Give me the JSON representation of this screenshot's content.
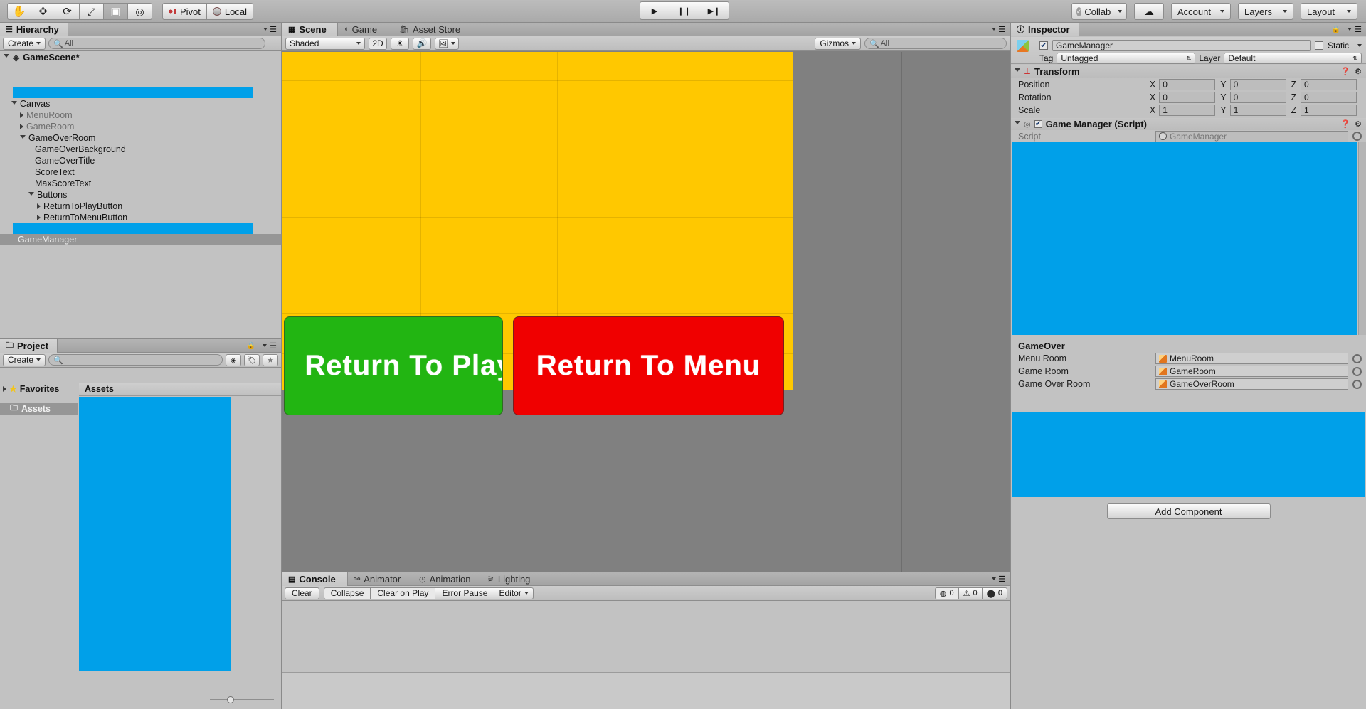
{
  "toolbar": {
    "tools": [
      {
        "name": "hand-tool",
        "glyph": "✋",
        "active": false
      },
      {
        "name": "move-tool",
        "glyph": "✥",
        "active": false
      },
      {
        "name": "rotate-tool",
        "glyph": "⟳",
        "active": false
      },
      {
        "name": "scale-tool",
        "glyph": "⤢",
        "active": false
      },
      {
        "name": "rect-tool",
        "glyph": "▣",
        "active": true
      },
      {
        "name": "transform-tool",
        "glyph": "◎",
        "active": false
      }
    ],
    "pivot_label": "Pivot",
    "local_label": "Local",
    "play_label": "▶",
    "pause_label": "❙❙",
    "step_label": "▶❙",
    "collab_label": "Collab",
    "cloud_label": "☁",
    "account_label": "Account",
    "layers_label": "Layers",
    "layout_label": "Layout"
  },
  "hierarchy": {
    "tab_label": "Hierarchy",
    "create_label": "Create",
    "search_placeholder": "All",
    "scene_name": "GameScene*",
    "items": [
      {
        "label": "",
        "depth": 1,
        "arrow": "none",
        "selected": true,
        "dim": false
      },
      {
        "label": "Canvas",
        "depth": 1,
        "arrow": "open",
        "selected": false,
        "dim": false
      },
      {
        "label": "MenuRoom",
        "depth": 2,
        "arrow": "closed",
        "selected": false,
        "dim": true
      },
      {
        "label": "GameRoom",
        "depth": 2,
        "arrow": "closed",
        "selected": false,
        "dim": true
      },
      {
        "label": "GameOverRoom",
        "depth": 2,
        "arrow": "open",
        "selected": false,
        "dim": false
      },
      {
        "label": "GameOverBackground",
        "depth": 3,
        "arrow": "none",
        "selected": false,
        "dim": false
      },
      {
        "label": "GameOverTitle",
        "depth": 3,
        "arrow": "none",
        "selected": false,
        "dim": false
      },
      {
        "label": "ScoreText",
        "depth": 3,
        "arrow": "none",
        "selected": false,
        "dim": false
      },
      {
        "label": "MaxScoreText",
        "depth": 3,
        "arrow": "none",
        "selected": false,
        "dim": false
      },
      {
        "label": "Buttons",
        "depth": 3,
        "arrow": "open",
        "selected": false,
        "dim": false
      },
      {
        "label": "ReturnToPlayButton",
        "depth": 4,
        "arrow": "closed",
        "selected": false,
        "dim": false
      },
      {
        "label": "ReturnToMenuButton",
        "depth": 4,
        "arrow": "closed",
        "selected": false,
        "dim": false
      },
      {
        "label": "",
        "depth": 1,
        "arrow": "none",
        "selected": true,
        "dim": false
      },
      {
        "label": "GameManager",
        "depth": 1,
        "arrow": "none",
        "selected": false,
        "dim": false,
        "highlight": true
      }
    ]
  },
  "project": {
    "tab_label": "Project",
    "create_label": "Create",
    "search_placeholder": "",
    "favorites_label": "Favorites",
    "assets_tree_label": "Assets",
    "assets_header": "Assets"
  },
  "scene": {
    "tabs": [
      {
        "label": "Scene",
        "icon": "grid-icon",
        "active": true
      },
      {
        "label": "Game",
        "icon": "gamepad-icon",
        "active": false
      },
      {
        "label": "Asset Store",
        "icon": "store-icon",
        "active": false
      }
    ],
    "shading_mode": "Shaded",
    "mode_2d_label": "2D",
    "lighting_icon": "sun-icon",
    "audio_icon": "speaker-icon",
    "fx_icon": "image-icon",
    "gizmos_label": "Gizmos",
    "search_placeholder": "All",
    "canvas": {
      "background_color": "#FFC800",
      "play_button": {
        "label": "Return To Play",
        "color": "#22B512",
        "text_color": "#FFFFFF"
      },
      "menu_button": {
        "label": "Return To Menu",
        "color": "#F00000",
        "text_color": "#FFFFFF"
      }
    }
  },
  "console": {
    "tabs": [
      {
        "label": "Console",
        "icon": "console-icon",
        "active": true
      },
      {
        "label": "Animator",
        "icon": "animator-icon",
        "active": false
      },
      {
        "label": "Animation",
        "icon": "animation-icon",
        "active": false
      },
      {
        "label": "Lighting",
        "icon": "lighting-icon",
        "active": false
      }
    ],
    "clear_label": "Clear",
    "collapse_label": "Collapse",
    "clear_on_play_label": "Clear on Play",
    "error_pause_label": "Error Pause",
    "editor_label": "Editor",
    "counts": {
      "info": "0",
      "warning": "0",
      "error": "0"
    }
  },
  "inspector": {
    "tab_label": "Inspector",
    "object_name": "GameManager",
    "object_enabled": true,
    "static_label": "Static",
    "tag_label": "Tag",
    "tag_value": "Untagged",
    "layer_label": "Layer",
    "layer_value": "Default",
    "transform": {
      "title": "Transform",
      "rows": [
        {
          "label": "Position",
          "x": "0",
          "y": "0",
          "z": "0"
        },
        {
          "label": "Rotation",
          "x": "0",
          "y": "0",
          "z": "0"
        },
        {
          "label": "Scale",
          "x": "1",
          "y": "1",
          "z": "1"
        }
      ],
      "axis_labels": [
        "X",
        "Y",
        "Z"
      ]
    },
    "script_component": {
      "title": "Game Manager (Script)",
      "enabled": true,
      "script_label": "Script",
      "script_value": "GameManager"
    },
    "gameover_section": {
      "header": "GameOver",
      "fields": [
        {
          "label": "Menu Room",
          "value": "MenuRoom"
        },
        {
          "label": "Game Room",
          "value": "GameRoom"
        },
        {
          "label": "Game Over Room",
          "value": "GameOverRoom"
        }
      ]
    },
    "add_component_label": "Add Component"
  },
  "colors": {
    "selection_blue": "#00A0E9",
    "canvas_yellow": "#FFC800",
    "green": "#22B512",
    "red": "#F00000"
  }
}
